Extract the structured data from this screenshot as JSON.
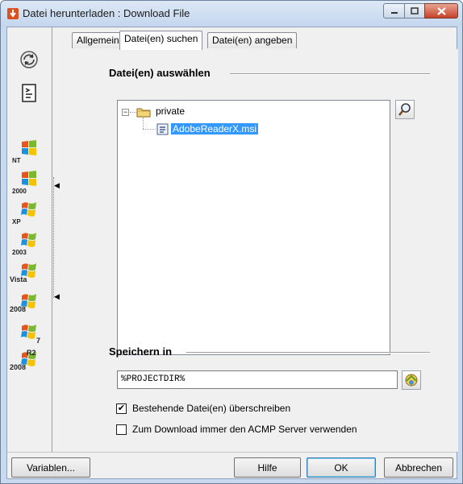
{
  "window": {
    "title": "Datei herunterladen : Download File"
  },
  "tabs": [
    {
      "label": "Allgemein",
      "active": false
    },
    {
      "label": "Datei(en) suchen",
      "active": true
    },
    {
      "label": "Datei(en) angeben",
      "active": false
    }
  ],
  "select_group": {
    "label": "Datei(en) auswählen"
  },
  "tree": {
    "folder": "private",
    "file": "AdobeReaderX.msi"
  },
  "save_group": {
    "label": "Speichern in",
    "path_value": "%PROJECTDIR%"
  },
  "options": {
    "overwrite_label": "Bestehende Datei(en) überschreiben",
    "overwrite_checked": true,
    "acmp_label": "Zum Download immer den ACMP Server verwenden",
    "acmp_checked": false
  },
  "os_labels": {
    "nt": "NT",
    "w2000": "2000",
    "xp": "XP",
    "w2003": "2003",
    "vista": "Vista",
    "w2008": "2008",
    "w7": "7",
    "r2_top": "R2",
    "r2_bottom": "2008"
  },
  "buttons": {
    "variables": "Variablen...",
    "help": "Hilfe",
    "ok": "OK",
    "cancel": "Abbrechen"
  },
  "icons": {
    "search": "magnifier-icon",
    "browse": "folder-browse-icon",
    "refresh": "refresh-icon",
    "script": "script-icon"
  },
  "colors": {
    "selection": "#3399ff",
    "title_bar": "#c4d6ee"
  }
}
